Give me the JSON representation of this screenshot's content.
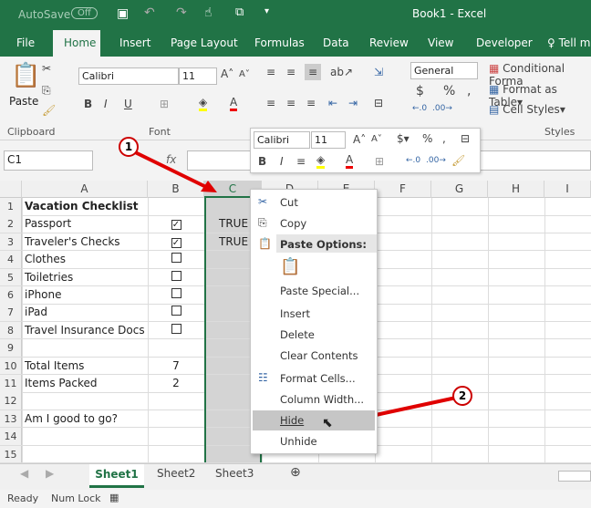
{
  "title": {
    "autosave": "AutoSave",
    "autosave_state": "Off",
    "doc": "Book1  -  Excel"
  },
  "tabs": [
    "File",
    "Home",
    "Insert",
    "Page Layout",
    "Formulas",
    "Data",
    "Review",
    "View",
    "Developer",
    "Tell m"
  ],
  "ribbon": {
    "paste": "Paste",
    "font": "Calibri",
    "size": "11",
    "number_format": "General",
    "conditional": "Conditional Forma",
    "format_table": "Format as Table",
    "cell_styles": "Cell Styles",
    "groups": [
      "Clipboard",
      "Font",
      "Styles"
    ]
  },
  "formula_bar": {
    "name_box": "C1",
    "fx": "fx"
  },
  "columns": [
    "A",
    "B",
    "C",
    "D",
    "E",
    "F",
    "G",
    "H",
    "I"
  ],
  "rows": [
    {
      "n": "1",
      "a": "Vacation Checklist",
      "b": "",
      "bold": true
    },
    {
      "n": "2",
      "a": "Passport",
      "check": true,
      "c": "TRUE"
    },
    {
      "n": "3",
      "a": "Traveler's Checks",
      "check": true,
      "c": "TRUE"
    },
    {
      "n": "4",
      "a": "Clothes",
      "check": false
    },
    {
      "n": "5",
      "a": "Toiletries",
      "check": false
    },
    {
      "n": "6",
      "a": "iPhone",
      "check": false
    },
    {
      "n": "7",
      "a": "iPad",
      "check": false
    },
    {
      "n": "8",
      "a": "Travel Insurance Docs",
      "check": false
    },
    {
      "n": "9",
      "a": ""
    },
    {
      "n": "10",
      "a": "Total Items",
      "b": "7"
    },
    {
      "n": "11",
      "a": "Items Packed",
      "b": "2"
    },
    {
      "n": "12",
      "a": ""
    },
    {
      "n": "13",
      "a": "Am I good to go?"
    },
    {
      "n": "14",
      "a": ""
    },
    {
      "n": "15",
      "a": ""
    }
  ],
  "mini_toolbar": {
    "font": "Calibri",
    "size": "11"
  },
  "context_menu": [
    "Cut",
    "Copy",
    "Paste Options:",
    "Paste Special...",
    "Insert",
    "Delete",
    "Clear Contents",
    "Format Cells...",
    "Column Width...",
    "Hide",
    "Unhide"
  ],
  "highlighted_item": "Hide",
  "sheets": [
    "Sheet1",
    "Sheet2",
    "Sheet3"
  ],
  "active_sheet": "Sheet1",
  "status": {
    "ready": "Ready",
    "numlock": "Num Lock"
  },
  "callouts": [
    "1",
    "2"
  ],
  "colors": {
    "excel_green": "#217346",
    "arrow_red": "#e00000"
  }
}
